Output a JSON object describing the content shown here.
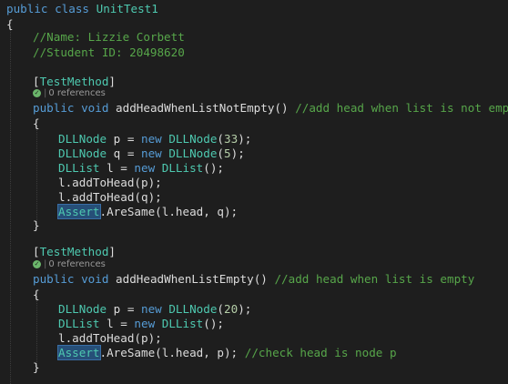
{
  "code": {
    "class_decl": {
      "kw_public": "public",
      "kw_class": "class",
      "name": "UnitTest1"
    },
    "open_brace": "{",
    "comment_name": "//Name: Lizzie Corbett",
    "comment_id": "//Student ID: 20498620",
    "method1": {
      "attribute_open": "[",
      "attribute": "TestMethod",
      "attribute_close": "]",
      "codelens": "0 references",
      "kw_public": "public",
      "kw_void": "void",
      "name": "addHeadWhenListNotEmpty",
      "params": "()",
      "comment": "//add head when list is not empty",
      "open": "{",
      "l1": {
        "type": "DLLNode",
        "rest": " p = ",
        "new": "new",
        "type2": "DLLNode",
        "args_open": "(",
        "num": "33",
        "args_close": ");"
      },
      "l2": {
        "type": "DLLNode",
        "rest": " q = ",
        "new": "new",
        "type2": "DLLNode",
        "args_open": "(",
        "num": "5",
        "args_close": ");"
      },
      "l3": {
        "type": "DLList",
        "rest": " l = ",
        "new": "new",
        "type2": "DLList",
        "args": "();"
      },
      "l4": "l.addToHead(p);",
      "l5": "l.addToHead(q);",
      "l6": {
        "cls": "Assert",
        "rest": ".AreSame(l.head, q);"
      },
      "close": "}"
    },
    "method2": {
      "attribute_open": "[",
      "attribute": "TestMethod",
      "attribute_close": "]",
      "codelens": "0 references",
      "kw_public": "public",
      "kw_void": "void",
      "name": "addHeadWhenListEmpty",
      "params": "()",
      "comment": "//add head when list is empty",
      "open": "{",
      "l1": {
        "type": "DLLNode",
        "rest": " p = ",
        "new": "new",
        "type2": "DLLNode",
        "args_open": "(",
        "num": "20",
        "args_close": ");"
      },
      "l2": {
        "type": "DLList",
        "rest": " l = ",
        "new": "new",
        "type2": "DLList",
        "args": "();"
      },
      "l3": "l.addToHead(p);",
      "l4": {
        "cls": "Assert",
        "rest": ".AreSame(l.head, p); ",
        "comment": "//check head is node p"
      },
      "close": "}"
    }
  },
  "colors": {
    "background": "#1e1e1e",
    "keyword": "#569cd6",
    "type": "#4ec9b0",
    "comment": "#57a64a",
    "number": "#b5cea8",
    "text": "#dcdcdc",
    "highlight": "#264f78"
  },
  "icons": {
    "codelens_status": "check-circle-icon"
  }
}
